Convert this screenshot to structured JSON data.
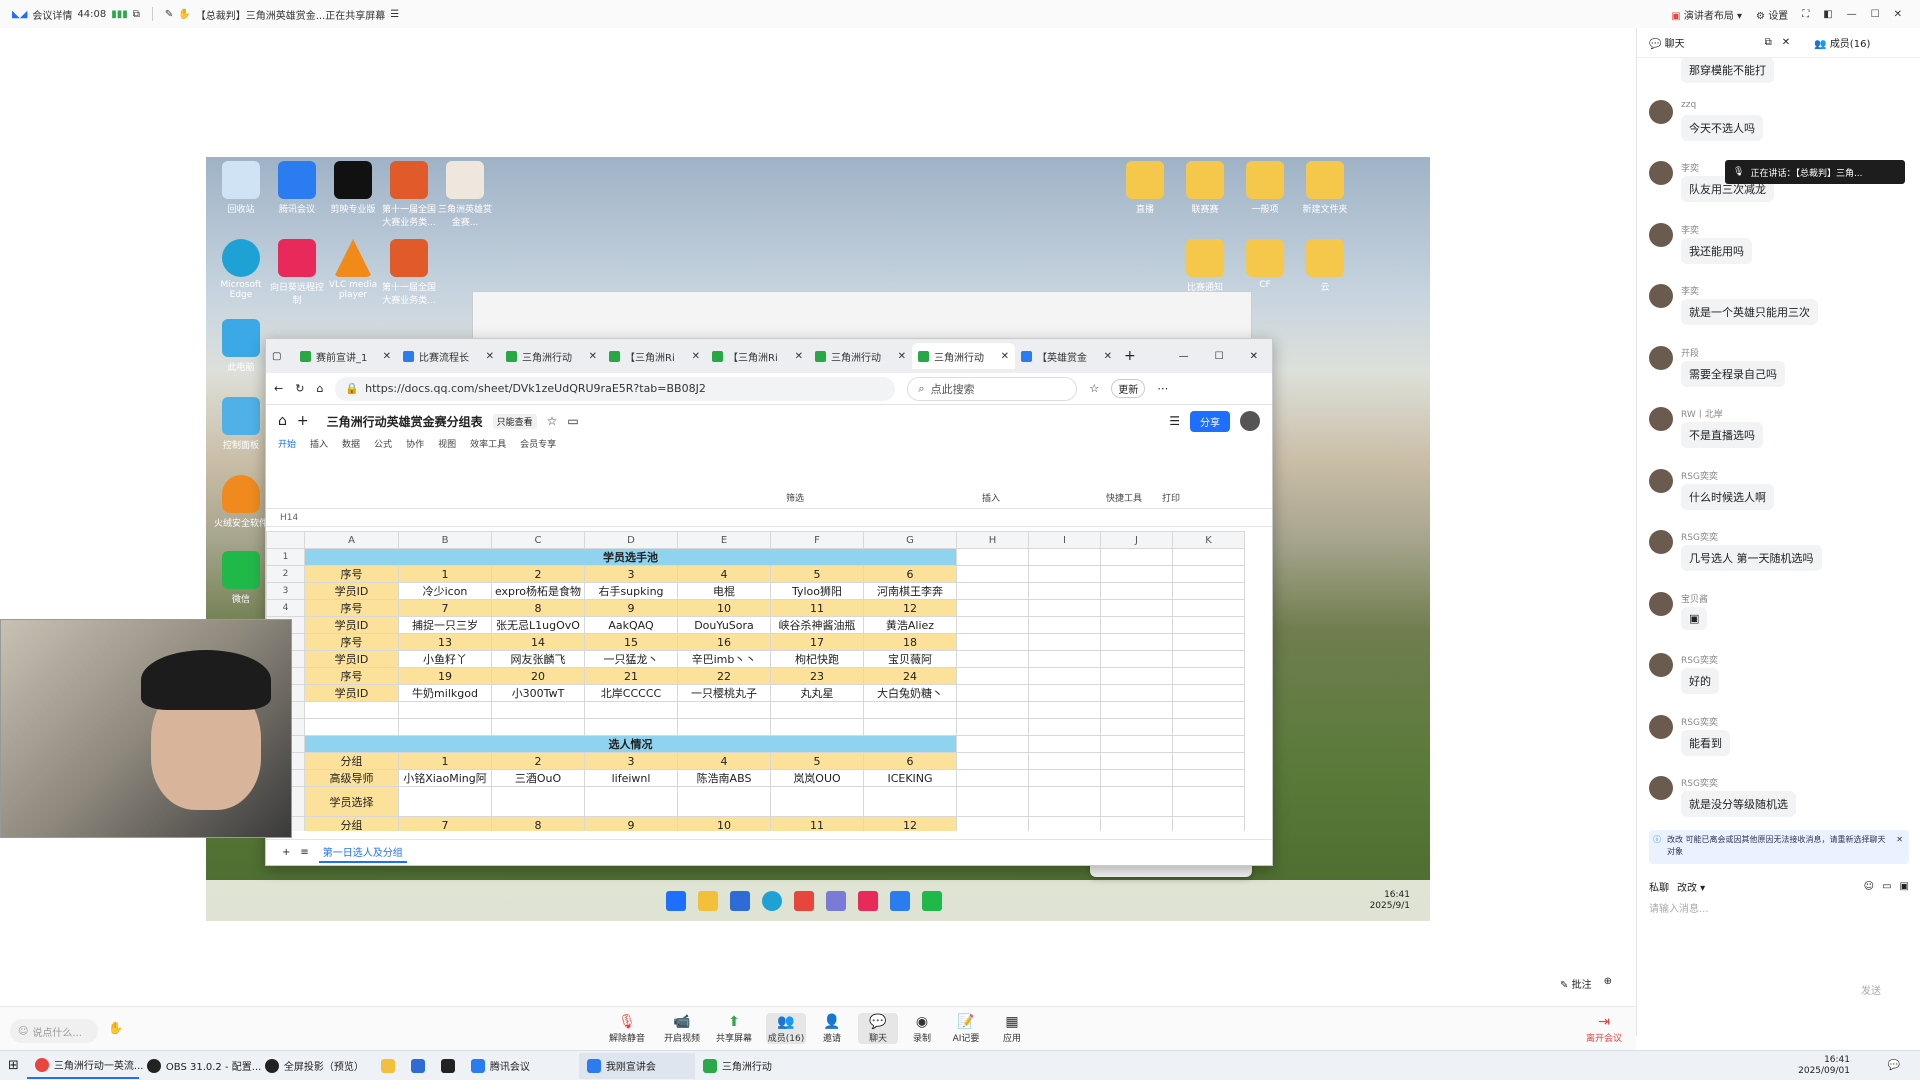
{
  "topbar": {
    "meeting_info": "会议详情",
    "timer": "44:08",
    "share_title": "【总裁判】三角洲英雄赏金...正在共享屏幕",
    "presenter_layout": "演讲者布局",
    "settings": "设置"
  },
  "chat": {
    "tab_chat": "聊天",
    "tab_members": "成员(16)",
    "speaking_now": "正在讲话：【总裁判】三角...",
    "messages": [
      {
        "name": "",
        "text": "那穿模能不能打"
      },
      {
        "name": "zzq",
        "text": "今天不选人吗"
      },
      {
        "name": "李奕",
        "text": "队友用三次减龙"
      },
      {
        "name": "李奕",
        "text": "我还能用吗"
      },
      {
        "name": "李奕",
        "text": "就是一个英雄只能用三次"
      },
      {
        "name": "开段",
        "text": "需要全程录自己吗"
      },
      {
        "name": "RW丨北岸",
        "text": "不是直播选吗"
      },
      {
        "name": "RSG奕奕",
        "text": "什么时候选人啊"
      },
      {
        "name": "RSG奕奕",
        "text": "几号选人 第一天随机选吗"
      },
      {
        "name": "宝贝酱",
        "text": "▣"
      },
      {
        "name": "RSG奕奕",
        "text": "好的"
      },
      {
        "name": "RSG奕奕",
        "text": "能看到"
      },
      {
        "name": "RSG奕奕",
        "text": "就是没分等级随机选"
      }
    ],
    "notice": "改改 可能已离会或因其他原因无法接收消息，请重新选择聊天对象",
    "private_label": "私聊",
    "recipient": "改改",
    "input_placeholder": "请输入消息...",
    "send": "发送"
  },
  "browser": {
    "tabs": [
      "赛前宣讲_1",
      "比赛流程长",
      "三角洲行动",
      "【三角洲Ri",
      "【三角洲Ri",
      "三角洲行动",
      "三角洲行动",
      "【英雄赏金"
    ],
    "url": "https://docs.qq.com/sheet/DVk1zeUdQRU9raE5R?tab=BB08J2",
    "search_placeholder": "点此搜索",
    "update": "更新",
    "doc_title": "三角洲行动英雄赏金赛分组表",
    "view_only": "只能查看",
    "share": "分享",
    "menus": [
      "开始",
      "插入",
      "数据",
      "公式",
      "协作",
      "视图",
      "效率工具",
      "会员专享"
    ],
    "ribbon_labels": [
      "筛选",
      "插入",
      "快捷工具",
      "打印"
    ],
    "cell_ref": "H14",
    "sheet_tab": "第一日选人及分组"
  },
  "sheet": {
    "columns": [
      "A",
      "B",
      "C",
      "D",
      "E",
      "F",
      "G",
      "H",
      "I",
      "J",
      "K"
    ],
    "section1_title": "学员选手池",
    "section2_title": "选人情况",
    "rows1": [
      [
        "序号",
        "1",
        "2",
        "3",
        "4",
        "5",
        "6"
      ],
      [
        "学员ID",
        "冷少icon",
        "expro杨柘是食物",
        "右手supking",
        "电棍",
        "Tyloo狮阳",
        "河南棋王李奔"
      ],
      [
        "序号",
        "7",
        "8",
        "9",
        "10",
        "11",
        "12"
      ],
      [
        "学员ID",
        "捕捉一只三岁",
        "张无忌L1ugOvO",
        "AakQAQ",
        "DouYuSora",
        "峡谷杀神酱油瓶",
        "黄浩Aliez"
      ],
      [
        "序号",
        "13",
        "14",
        "15",
        "16",
        "17",
        "18"
      ],
      [
        "学员ID",
        "小鱼籽丫",
        "网友张麟飞",
        "一只猛龙丶",
        "辛巴imb丶丶",
        "枸杞快跑",
        "宝贝薇阿"
      ],
      [
        "序号",
        "19",
        "20",
        "21",
        "22",
        "23",
        "24"
      ],
      [
        "学员ID",
        "牛奶milkgod",
        "小300TwT",
        "北岸CCCCC",
        "一只樱桃丸子",
        "丸丸星",
        "大白兔奶糖丶"
      ]
    ],
    "rows2": [
      [
        "分组",
        "1",
        "2",
        "3",
        "4",
        "5",
        "6"
      ],
      [
        "高级导师",
        "小铭XiaoMing阿",
        "三酒OuO",
        "lifeiwnl",
        "陈浩南ABS",
        "岚岚OUO",
        "ICEKING"
      ],
      [
        "学员选择",
        "",
        "",
        "",
        "",
        "",
        ""
      ],
      [
        "分组",
        "7",
        "8",
        "9",
        "10",
        "11",
        "12"
      ]
    ]
  },
  "desktop": {
    "icons": [
      "回收站",
      "腾讯会议",
      "剪映专业版",
      "第十一届全国大赛业务类...",
      "三角洲英雄赏金赛...",
      "Microsoft Edge",
      "向日葵远程控制",
      "VLC media player",
      "第十一届全国大赛业务类...",
      "此电脑",
      "控制面板",
      "火绒安全软件",
      "微信"
    ],
    "folders": [
      "直播",
      "联赛赛",
      "一般项",
      "新建文件夹",
      "比赛通知",
      "CF",
      "云"
    ],
    "clock_time": "16:41",
    "clock_date": "2025/9/1"
  },
  "bottombar": {
    "speak_hint": "说点什么...",
    "buttons": [
      "解除静音",
      "开启视频",
      "共享屏幕",
      "成员(16)",
      "邀请",
      "聊天",
      "录制",
      "AI记要",
      "应用"
    ],
    "leave": "离开会议",
    "annotate": "批注"
  },
  "taskbar": {
    "apps": [
      "三角洲行动一英流...",
      "OBS 31.0.2 - 配置...",
      "全屏投影（预览）",
      "腾讯会议",
      "我刚宣讲会",
      "三角洲行动"
    ],
    "time": "16:41",
    "date": "2025/09/01"
  },
  "colors": {
    "accent": "#1e6fff",
    "sheet_yellow": "#fbe19a",
    "sheet_blue": "#8fd3ef",
    "leave_red": "#e8453c"
  }
}
